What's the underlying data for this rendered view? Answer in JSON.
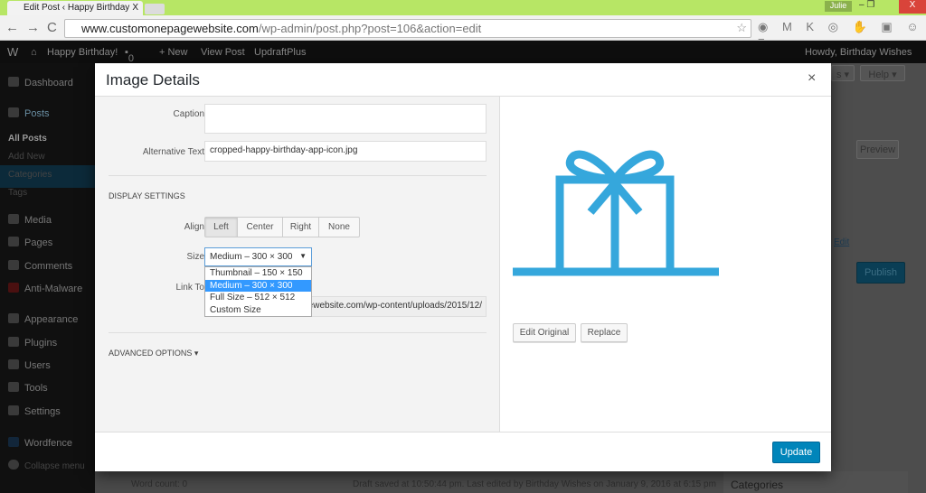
{
  "browser": {
    "tab_title": "Edit Post ‹ Happy Birthday",
    "tab_close": "X",
    "user_badge": "Julie",
    "window_controls": "–  ❐",
    "window_close": "X",
    "url_host": "www.customonepagewebsite.com",
    "url_path": "/wp-admin/post.php?post=106&action=edit",
    "nav_icons": "←→C",
    "extension_icons": "◉ M K ◎ ✋ ▣ ☺ ≡"
  },
  "adminbar": {
    "wp_logo": "W",
    "site": "Happy Birthday!",
    "comments": "0",
    "new": "+ New",
    "view_post": "View Post",
    "updraft": "UpdraftPlus",
    "howdy": "Howdy, Birthday Wishes"
  },
  "sidebar": {
    "items": [
      {
        "label": "Dashboard"
      },
      {
        "label": "Posts"
      },
      {
        "label": "Media"
      },
      {
        "label": "Pages"
      },
      {
        "label": "Comments"
      },
      {
        "label": "Anti-Malware"
      },
      {
        "label": "Appearance"
      },
      {
        "label": "Plugins"
      },
      {
        "label": "Users"
      },
      {
        "label": "Tools"
      },
      {
        "label": "Settings"
      },
      {
        "label": "Wordfence"
      },
      {
        "label": "Collapse menu"
      }
    ],
    "sub": [
      {
        "label": "All Posts"
      },
      {
        "label": "Add New"
      },
      {
        "label": "Categories"
      },
      {
        "label": "Tags"
      }
    ]
  },
  "background": {
    "help": "Help ▾",
    "screen_options": "s ▾",
    "preview": "Preview",
    "edit_link": "Edit",
    "publish": "Publish",
    "categories": "Categories",
    "word_count": "Word count: 0",
    "draft_status": "Draft saved at 10:50:44 pm. Last edited by Birthday Wishes on January 9, 2016 at 6:15 pm"
  },
  "modal": {
    "title": "Image Details",
    "close": "×",
    "caption_label": "Caption",
    "caption_value": "",
    "alt_label": "Alternative Text",
    "alt_value": "cropped-happy-birthday-app-icon.jpg",
    "display_settings": "DISPLAY SETTINGS",
    "align_label": "Align",
    "align_options": [
      "Left",
      "Center",
      "Right",
      "None"
    ],
    "align_selected": "Left",
    "size_label": "Size",
    "size_selected": "Medium – 300 × 300",
    "size_options": [
      "Thumbnail – 150 × 150",
      "Medium – 300 × 300",
      "Full Size – 512 × 512",
      "Custom Size"
    ],
    "link_label": "Link To",
    "link_url": "ewebsite.com/wp-content/uploads/2015/12/",
    "advanced": "ADVANCED OPTIONS ▾",
    "edit_original": "Edit Original",
    "replace": "Replace",
    "update": "Update",
    "image_color": "#35a7dc"
  }
}
